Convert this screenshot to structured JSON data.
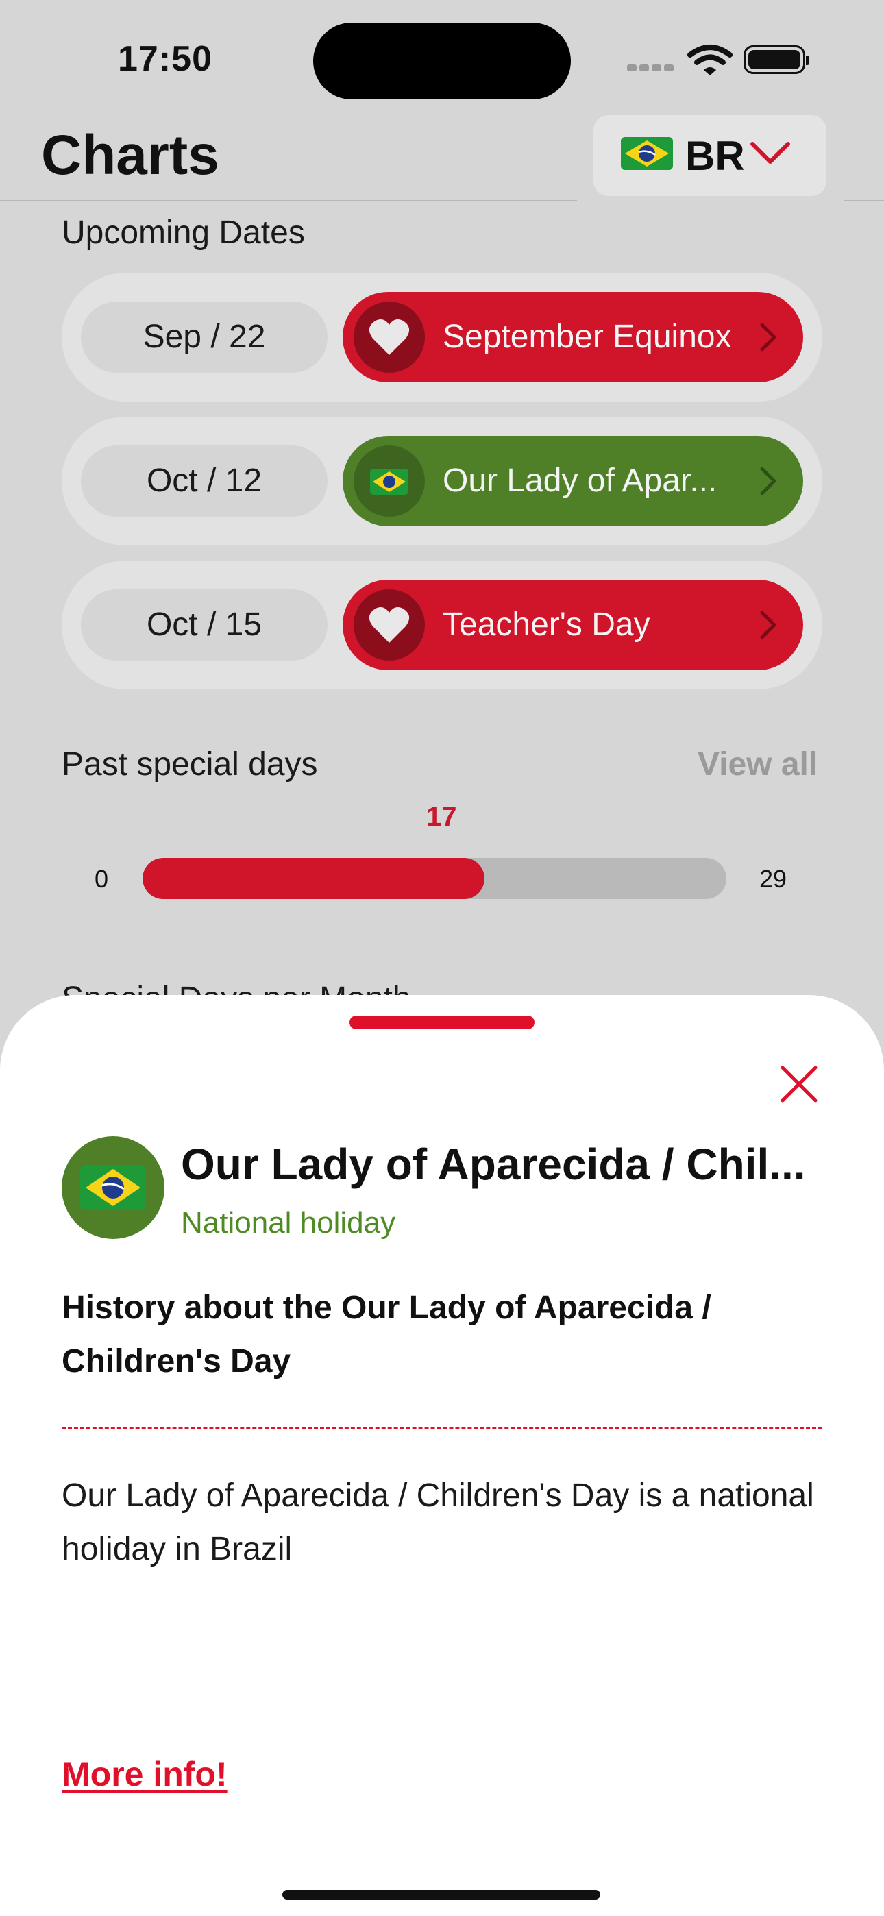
{
  "status_bar": {
    "time": "17:50"
  },
  "header": {
    "title": "Charts",
    "country_code": "BR"
  },
  "upcoming": {
    "title": "Upcoming Dates",
    "items": [
      {
        "date": "Sep / 22",
        "name": "September Equinox",
        "color": "#d0142a",
        "icon": "heart-icon"
      },
      {
        "date": "Oct / 12",
        "name": "Our Lady of Apar...",
        "color": "#4f8027",
        "icon": "brazil-flag-icon"
      },
      {
        "date": "Oct / 15",
        "name": "Teacher's Day",
        "color": "#d0142a",
        "icon": "heart-icon"
      }
    ]
  },
  "past": {
    "title": "Past special days",
    "view_all": "View all",
    "value": "17",
    "min": "0",
    "max": "29",
    "fraction": 0.586
  },
  "cut_off_section": {
    "title": "Special Days per Month"
  },
  "sheet": {
    "title": "Our Lady of Aparecida / Chil...",
    "type": "National holiday",
    "history_heading": "History about the Our Lady of Aparecida / Children's Day",
    "history_body": "Our Lady of Aparecida / Children's Day is a national holiday in Brazil",
    "more_info": "More info!"
  },
  "colors": {
    "accent": "#e0102a",
    "green": "#4f8027",
    "background": "#d6d6d6"
  }
}
